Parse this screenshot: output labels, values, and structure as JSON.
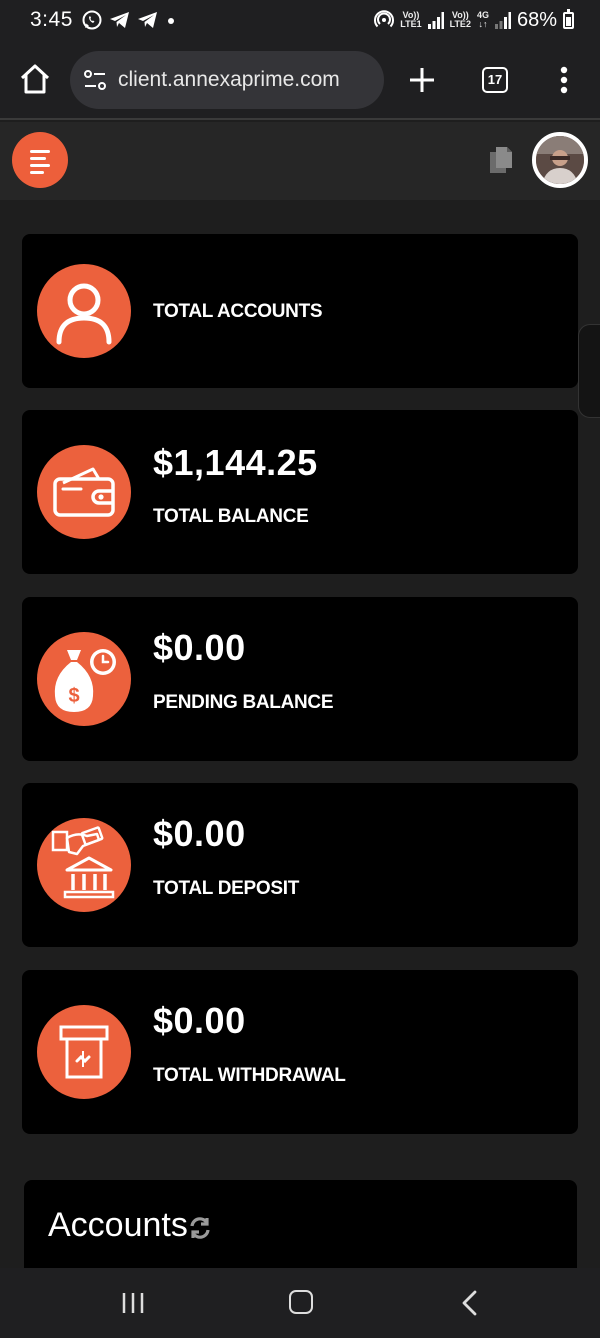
{
  "status_bar": {
    "time": "3:45",
    "net1_top": "Vo))",
    "net1_bottom": "LTE1",
    "net2_top": "Vo))",
    "net2_bottom": "LTE2",
    "net3_top": "4G",
    "net3_bottom": "↓↑",
    "battery": "68%"
  },
  "browser": {
    "url": "client.annexaprime.com",
    "tab_count": "17"
  },
  "stats": [
    {
      "value": "",
      "label": "TOTAL ACCOUNTS",
      "icon": "user-icon"
    },
    {
      "value": "$1,144.25",
      "label": "TOTAL BALANCE",
      "icon": "wallet-icon"
    },
    {
      "value": "$0.00",
      "label": "PENDING BALANCE",
      "icon": "money-bag-clock-icon"
    },
    {
      "value": "$0.00",
      "label": "TOTAL DEPOSIT",
      "icon": "bank-deposit-icon"
    },
    {
      "value": "$0.00",
      "label": "TOTAL WITHDRAWAL",
      "icon": "atm-withdrawal-icon"
    }
  ],
  "accounts": {
    "title": "Accounts"
  },
  "colors": {
    "accent": "#ec613d",
    "card_bg": "#000000",
    "page_bg": "#1e1e1e"
  }
}
